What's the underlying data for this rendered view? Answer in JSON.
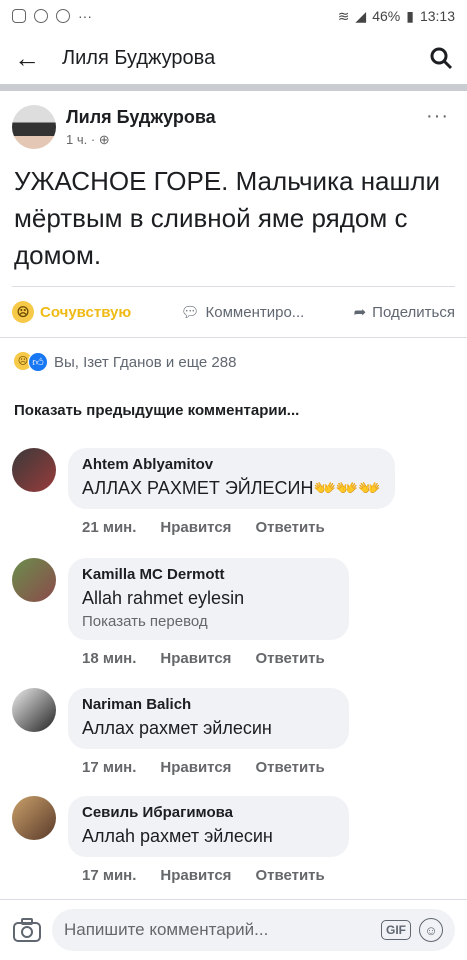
{
  "status": {
    "battery": "46%",
    "time": "13:13",
    "dots": "···"
  },
  "header": {
    "title": "Лиля Буджурова"
  },
  "post": {
    "author": "Лиля Буджурова",
    "time": "1 ч. ·",
    "text": "УЖАСНОЕ ГОРЕ. Мальчика нашли мёртвым в сливной яме рядом с домом.",
    "more": "···"
  },
  "actions": {
    "react": "Сочувствую",
    "comment": "Комментиро...",
    "share": "Поделиться"
  },
  "reactions_text": "Вы, Ізет Гданов и еще 288",
  "show_previous": "Показать предыдущие комментарии...",
  "comments": [
    {
      "name": "Ahtem Ablyamitov",
      "text": "АЛЛАХ РАХМЕТ ЭЙЛЕСИН👐👐👐",
      "time": "21 мин.",
      "like": "Нравится",
      "reply": "Ответить"
    },
    {
      "name": "Kamilla MC Dermott",
      "text": "Allah rahmet eylesin",
      "translate": "Показать перевод",
      "time": "18 мин.",
      "like": "Нравится",
      "reply": "Ответить"
    },
    {
      "name": "Nariman Balich",
      "text": "Аллах рахмет эйлесин",
      "time": "17 мин.",
      "like": "Нравится",
      "reply": "Ответить"
    },
    {
      "name": "Севиль Ибрагимова",
      "text": "Аллаh рахмет эйлесин",
      "time": "17 мин.",
      "like": "Нравится",
      "reply": "Ответить"
    }
  ],
  "composer": {
    "placeholder": "Напишите комментарий...",
    "gif": "GIF"
  }
}
